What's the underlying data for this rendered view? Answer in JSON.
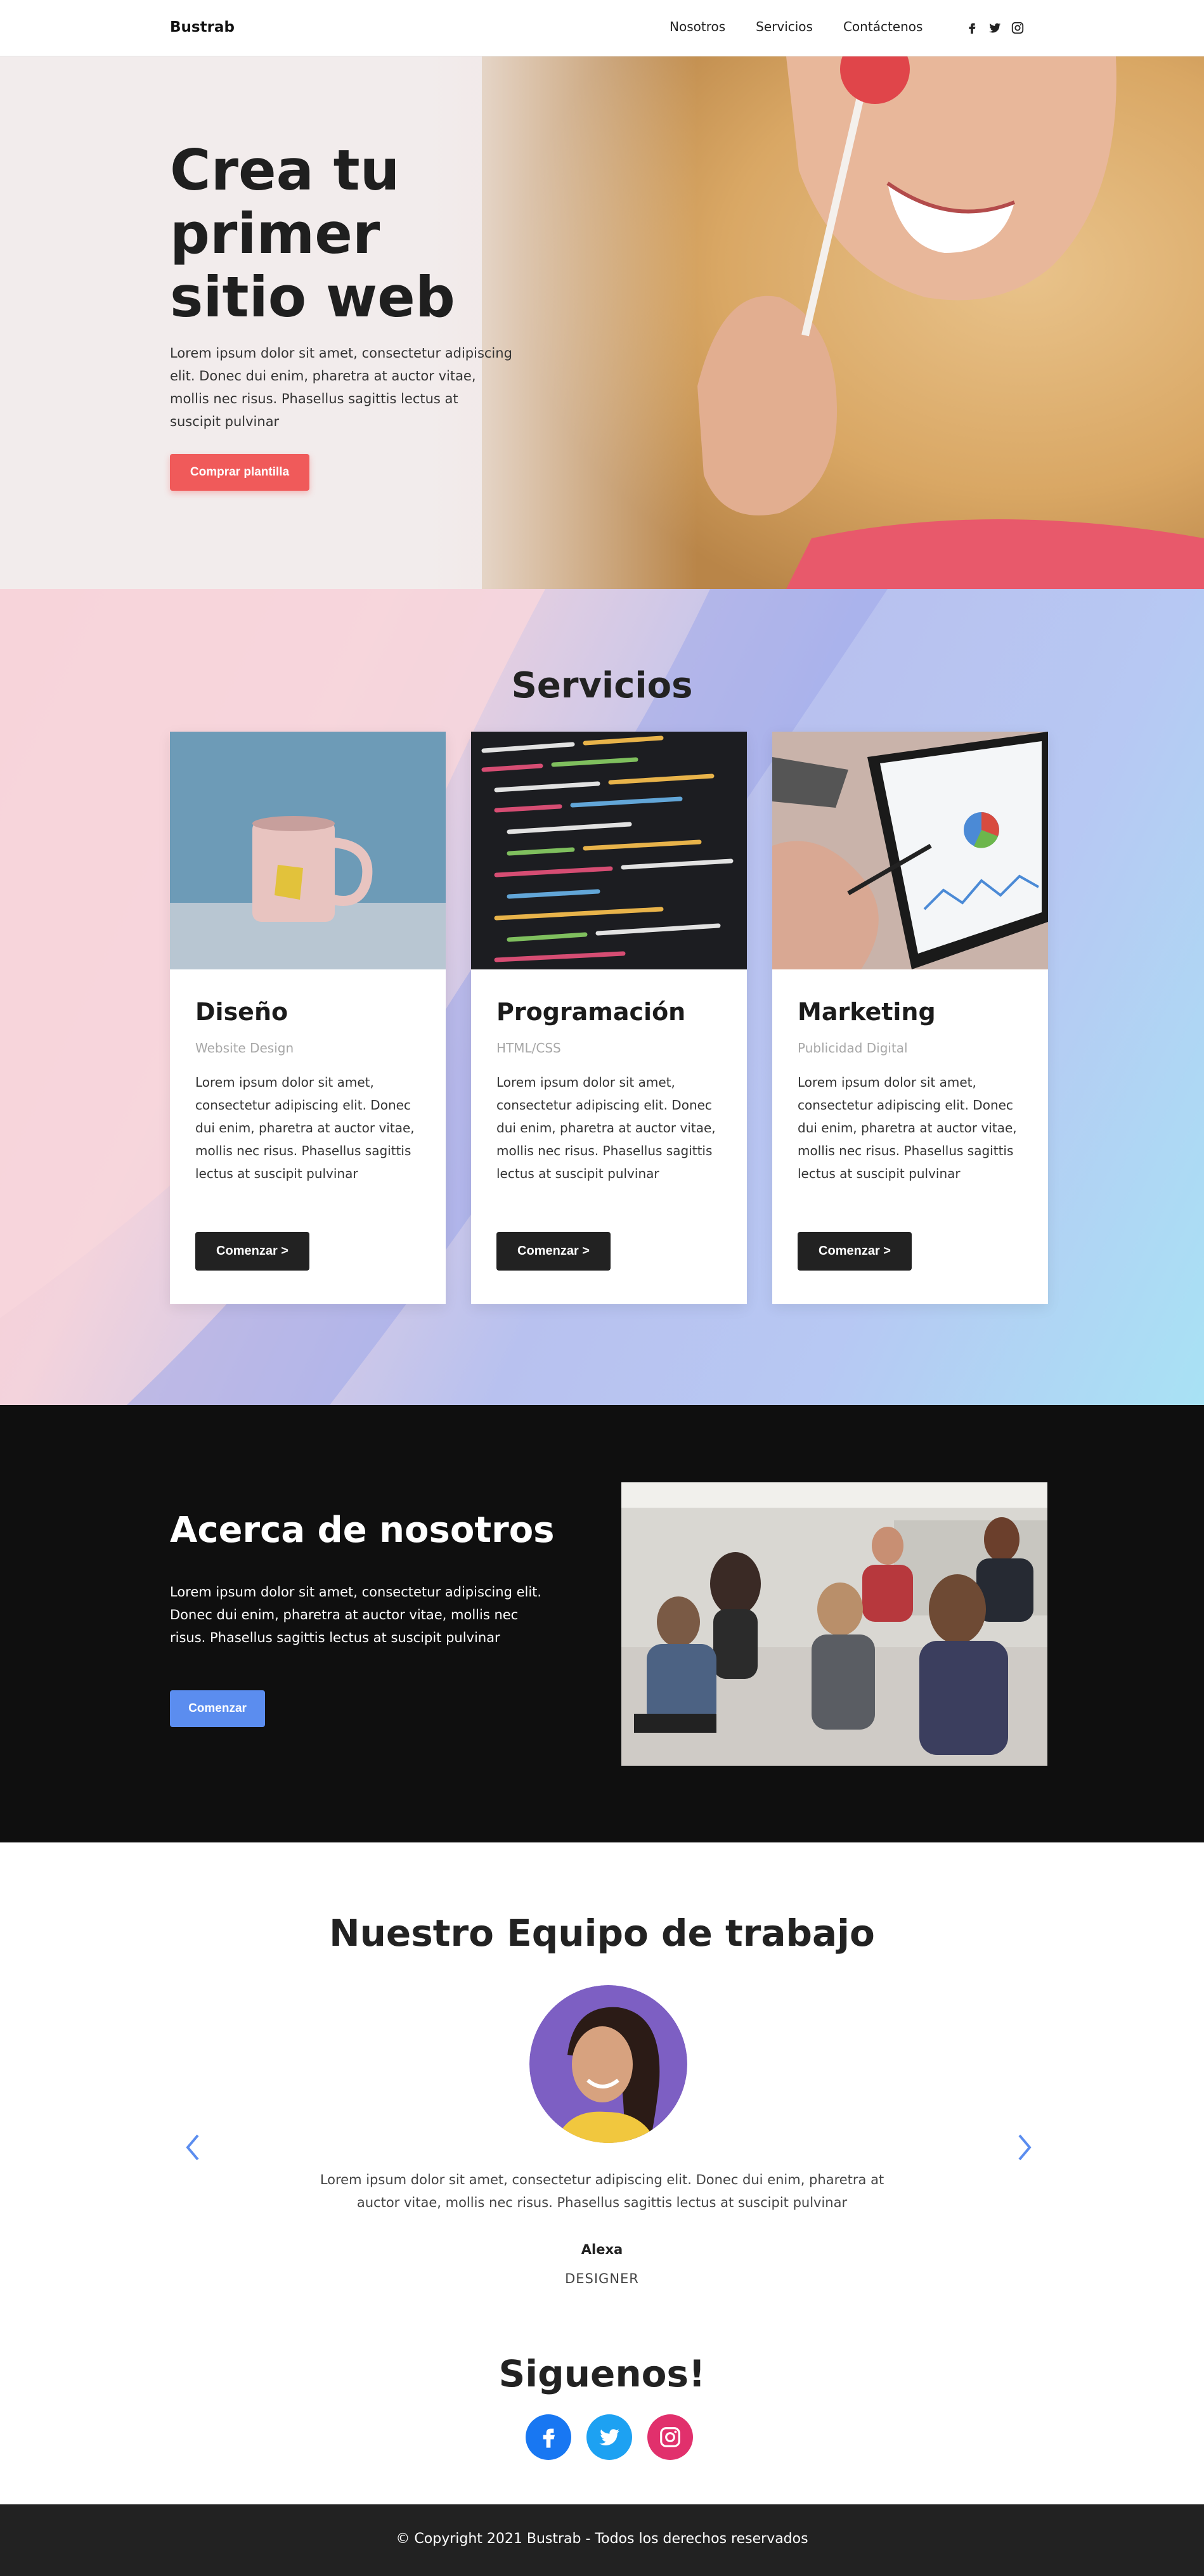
{
  "nav": {
    "brand": "Bustrab",
    "links": [
      "Nosotros",
      "Servicios",
      "Contáctenos"
    ],
    "social": [
      "facebook-icon",
      "twitter-icon",
      "instagram-icon"
    ]
  },
  "hero": {
    "title": "Crea tu primer sitio web",
    "text": "Lorem ipsum dolor sit amet, consectetur adipiscing elit. Donec dui enim, pharetra at auctor vitae, mollis nec risus. Phasellus sagittis lectus at suscipit pulvinar",
    "button": "Comprar plantilla"
  },
  "services": {
    "title": "Servicios",
    "cards": [
      {
        "title": "Diseño",
        "subtitle": "Website Design",
        "text": "Lorem ipsum dolor sit amet, consectetur adipiscing elit. Donec dui enim, pharetra at auctor vitae, mollis nec risus. Phasellus sagittis lectus at suscipit pulvinar",
        "button": "Comenzar >"
      },
      {
        "title": "Programación",
        "subtitle": "HTML/CSS",
        "text": "Lorem ipsum dolor sit amet, consectetur adipiscing elit. Donec dui enim, pharetra at auctor vitae, mollis nec risus. Phasellus sagittis lectus at suscipit pulvinar",
        "button": "Comenzar >"
      },
      {
        "title": "Marketing",
        "subtitle": "Publicidad Digital",
        "text": "Lorem ipsum dolor sit amet, consectetur adipiscing elit. Donec dui enim, pharetra at auctor vitae, mollis nec risus. Phasellus sagittis lectus at suscipit pulvinar",
        "button": "Comenzar >"
      }
    ]
  },
  "about": {
    "title": "Acerca de nosotros",
    "text": "Lorem ipsum dolor sit amet, consectetur adipiscing elit. Donec dui enim, pharetra at auctor vitae, mollis nec risus. Phasellus sagittis lectus at suscipit pulvinar",
    "button": "Comenzar"
  },
  "team": {
    "title": "Nuestro Equipo de trabajo",
    "text": "Lorem ipsum dolor sit amet, consectetur adipiscing elit. Donec dui enim, pharetra at auctor vitae, mollis nec risus. Phasellus sagittis lectus at suscipit pulvinar",
    "name": "Alexa",
    "role": "DESIGNER"
  },
  "follow": {
    "title": "Siguenos!",
    "icons": [
      "facebook-icon",
      "twitter-icon",
      "instagram-icon"
    ],
    "colors": {
      "facebook": "#1877f2",
      "twitter": "#1da1f2",
      "instagram": "#e1306c"
    }
  },
  "footer": {
    "text": "© Copyright 2021 Bustrab - Todos los derechos reservados"
  },
  "colors": {
    "accent_red": "#f05a5a",
    "accent_blue": "#5b8def",
    "dark": "#222222"
  }
}
